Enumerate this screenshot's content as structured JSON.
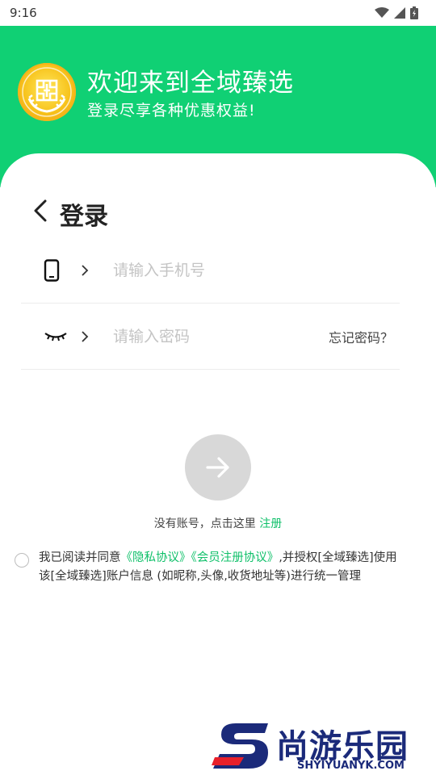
{
  "status_bar": {
    "time": "9:16"
  },
  "header": {
    "title": "欢迎来到全域臻选",
    "subtitle": "登录尽享各种优惠权益!"
  },
  "login": {
    "title": "登录",
    "phone_placeholder": "请输入手机号",
    "password_placeholder": "请输入密码",
    "forgot_label": "忘记密码？",
    "no_account_text": "没有账号，点击这里",
    "register_label": "注册"
  },
  "agreement": {
    "prefix": "我已阅读并同意",
    "privacy_link": "《隐私协议》",
    "member_link": "《会员注册协议》",
    "suffix": ",并授权[全域臻选]使用该[全域臻选]账户信息 (如昵称,头像,收货地址等)进行统一管理"
  },
  "watermark": {
    "cn": "尚游乐园",
    "en": "SHYIYUANYK.COM"
  },
  "colors": {
    "brand_green": "#10d074",
    "link_green": "#10c06a",
    "button_gray": "#d8d8d8"
  },
  "icons": {
    "back": "chevron-left-icon",
    "phone": "smartphone-icon",
    "password": "closed-eye-icon",
    "submit": "arrow-right-icon"
  }
}
